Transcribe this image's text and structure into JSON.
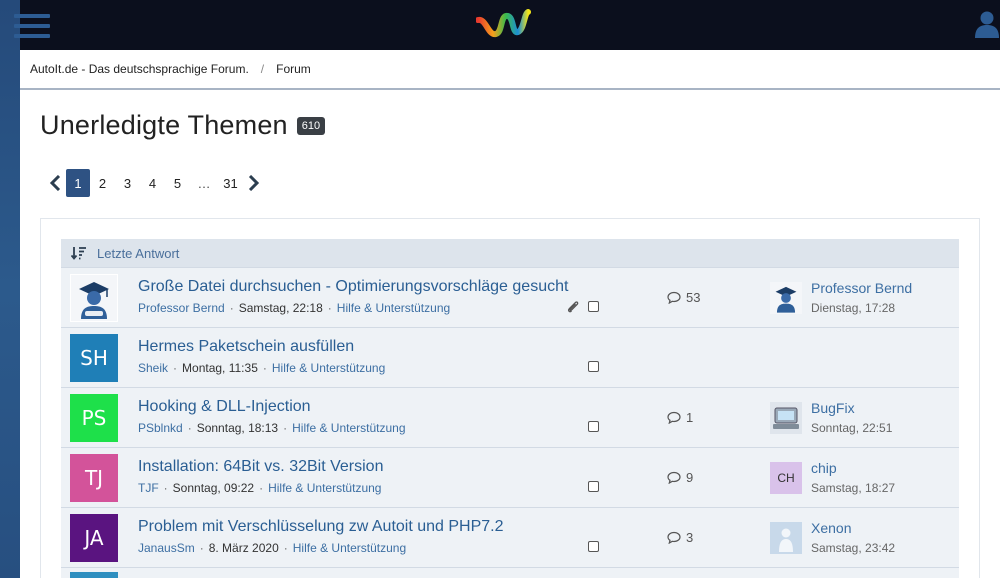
{
  "header": {
    "logo_icon": "autoit-wave-logo-icon",
    "menu_icon": "hamburger-menu-icon",
    "user_icon": "user-icon"
  },
  "breadcrumb": {
    "items": [
      {
        "label": "AutoIt.de - Das deutschsprachige Forum."
      },
      {
        "label": "Forum"
      }
    ],
    "separator": "/"
  },
  "page": {
    "title": "Unerledigte Themen",
    "count": "610"
  },
  "pagination": {
    "pages": [
      "1",
      "2",
      "3",
      "4",
      "5"
    ],
    "ellipsis": "…",
    "last": "31",
    "current": "1"
  },
  "list": {
    "sort_label": "Letzte Antwort",
    "topics": [
      {
        "title": "Große Datei durchsuchen - Optimierungsvorschläge gesucht",
        "author": "Professor Bernd",
        "date": "Samstag, 22:18",
        "board": "Hilfe & Unterstützung",
        "replies": "53",
        "has_attachment": true,
        "avatar_initials": "",
        "avatar_color": "#ffffff",
        "avatar_icon": "graduate-avatar-icon",
        "last_user": "Professor Bernd",
        "last_date": "Dienstag, 17:28",
        "last_avatar_initials": "",
        "last_avatar_icon": "graduate-avatar-icon"
      },
      {
        "title": "Hermes Paketschein ausfüllen",
        "author": "Sheik",
        "date": "Montag, 11:35",
        "board": "Hilfe & Unterstützung",
        "replies": "",
        "has_attachment": false,
        "avatar_initials": "SH",
        "avatar_color": "#1f7fb7",
        "last_user": "",
        "last_date": ""
      },
      {
        "title": "Hooking & DLL-Injection",
        "author": "PSblnkd",
        "date": "Sonntag, 18:13",
        "board": "Hilfe & Unterstützung",
        "replies": "1",
        "has_attachment": false,
        "avatar_initials": "PS",
        "avatar_color": "#1ee04a",
        "last_user": "BugFix",
        "last_date": "Sonntag, 22:51",
        "last_avatar_initials": "",
        "last_avatar_icon": "computer-avatar-icon"
      },
      {
        "title": "Installation: 64Bit vs. 32Bit Version",
        "author": "TJF",
        "date": "Sonntag, 09:22",
        "board": "Hilfe & Unterstützung",
        "replies": "9",
        "has_attachment": false,
        "avatar_initials": "TJ",
        "avatar_color": "#d3539a",
        "last_user": "chip",
        "last_date": "Samstag, 18:27",
        "last_avatar_initials": "CH",
        "last_avatar_color": "#d9c2ea"
      },
      {
        "title": "Problem mit Verschlüsselung zw Autoit und PHP7.2",
        "author": "JanausSm",
        "date": "8. März 2020",
        "board": "Hilfe & Unterstützung",
        "replies": "3",
        "has_attachment": false,
        "avatar_initials": "JA",
        "avatar_color": "#5a1480",
        "last_user": "Xenon",
        "last_date": "Samstag, 23:42",
        "last_avatar_initials": "",
        "last_avatar_icon": "figure-avatar-icon"
      }
    ]
  }
}
